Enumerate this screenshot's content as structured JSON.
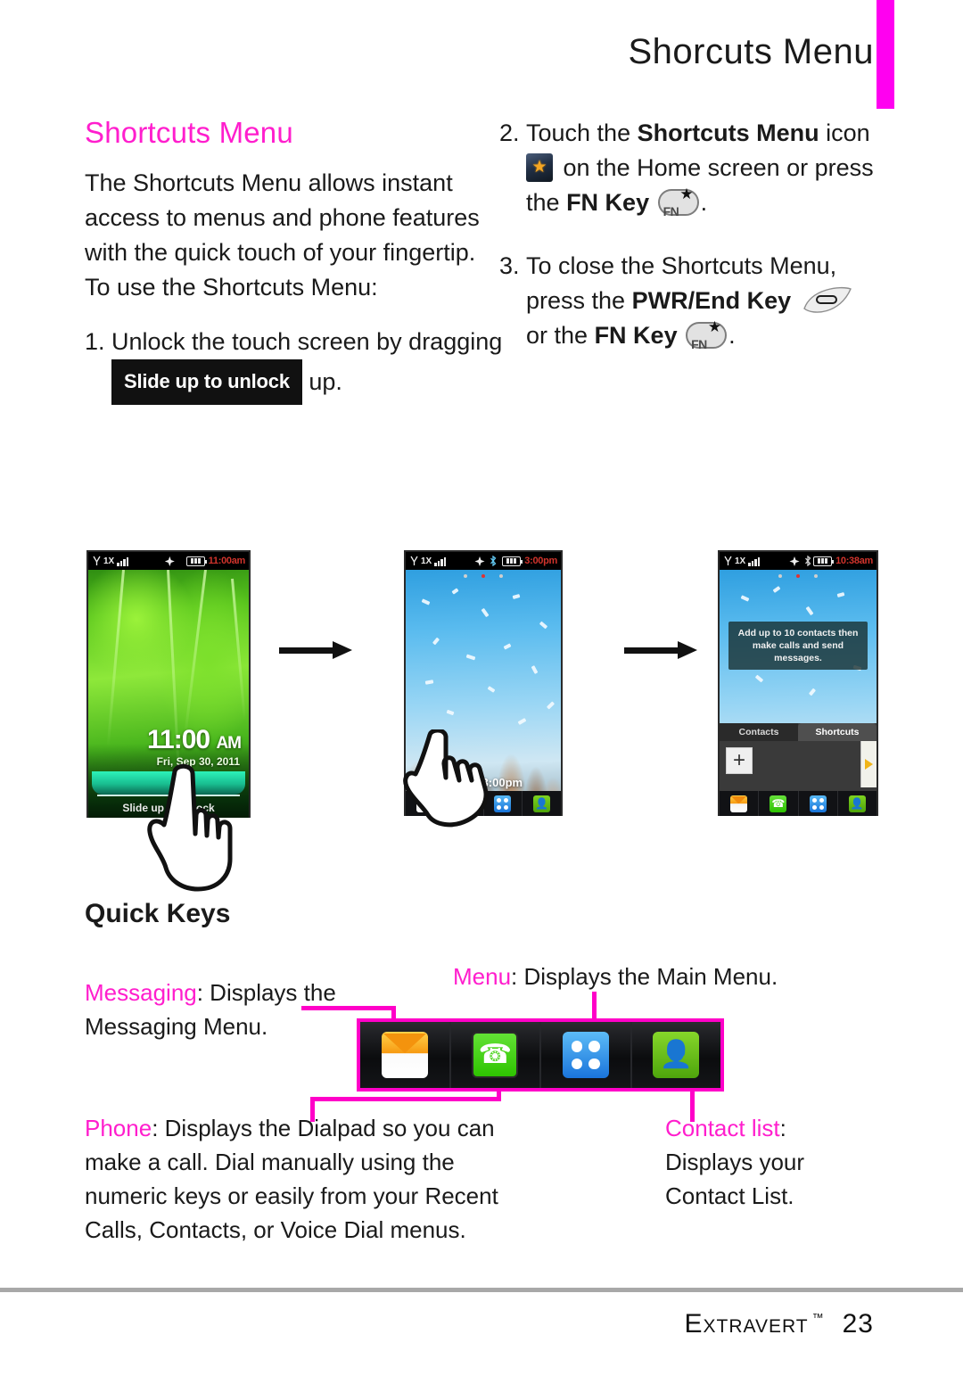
{
  "header": {
    "running_title": "Shorcuts Menu",
    "accent_color": "#ff00f0"
  },
  "section": {
    "title": "Shortcuts Menu",
    "intro": "The Shortcuts Menu allows instant access to menus and phone features with the quick touch of your fingertip. To use the Shortcuts Menu:"
  },
  "steps": [
    {
      "num": "1.",
      "part1": "Unlock the touch screen by dragging",
      "badge": "Slide up to unlock",
      "part2": "up."
    },
    {
      "num": "2.",
      "part1": "Touch the",
      "bold1": "Shortcuts Menu",
      "part2": "icon",
      "icon_name": "shortcuts-menu-star-icon",
      "part3": "on the Home screen or press the",
      "bold2": "FN Key",
      "key1": "FN",
      "part4": "."
    },
    {
      "num": "3.",
      "part1": "To close the Shortcuts Menu, press the",
      "bold1": "PWR/End Key",
      "part2": "or the",
      "bold2": "FN Key",
      "key1": "FN",
      "part3": "."
    }
  ],
  "figures": {
    "phone1": {
      "label": "lock-screen",
      "status": {
        "signal": "1X",
        "gps": "gps-icon",
        "time": "11:00am"
      },
      "clock": "11:00",
      "clock_ampm": "AM",
      "date": "Fri, Sep 30, 2011",
      "slider_label": "Slide up to unlock"
    },
    "phone2": {
      "label": "home-screen",
      "status": {
        "signal": "1X",
        "gps": "gps-icon",
        "bluetooth": "bluetooth-icon",
        "time": "3:00pm"
      },
      "date_widget": "Nov 5, 3:00pm",
      "dock": [
        "messaging",
        "phone",
        "menu",
        "contacts"
      ]
    },
    "phone3": {
      "label": "shortcuts-menu-open",
      "status": {
        "signal": "1X",
        "gps": "gps-icon",
        "bluetooth": "bluetooth-icon",
        "time": "10:38am"
      },
      "tooltip": "Add up to 10 contacts then make calls and send messages.",
      "tabs": [
        "Contacts",
        "Shortcuts"
      ],
      "active_tab": "Shortcuts",
      "add_button": "+",
      "dock": [
        "messaging",
        "phone",
        "menu",
        "contacts"
      ]
    }
  },
  "quick_keys": {
    "title": "Quick Keys",
    "accent_color": "#ff00c8",
    "callouts": {
      "messaging": {
        "name": "Messaging",
        "desc": ": Displays the Messaging Menu."
      },
      "menu": {
        "name": "Menu",
        "desc": ": Displays the Main Menu."
      },
      "phone": {
        "name": "Phone",
        "desc": ": Displays the Dialpad so you can make a call. Dial manually using the numeric keys or easily from your Recent Calls, Contacts, or Voice Dial menus."
      },
      "contact_list": {
        "name": "Contact list",
        "desc": ":",
        "desc2": "Displays your Contact List."
      }
    },
    "dock_icons": [
      "messaging-icon",
      "phone-icon",
      "menu-icon",
      "contacts-icon"
    ]
  },
  "footer": {
    "brand": "Extravert",
    "trademark": "™",
    "page_number": "23"
  }
}
